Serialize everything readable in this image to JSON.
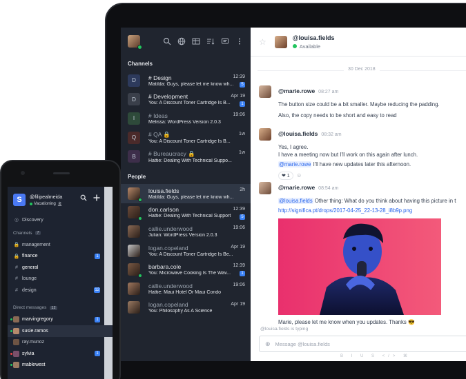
{
  "colors": {
    "accent": "#3b82f6",
    "online": "#22c55e",
    "sidebar": "#20252f",
    "mention_bg": "#e8efff",
    "link": "#2563eb"
  },
  "tablet": {
    "sidebar": {
      "icons": [
        "search-icon",
        "globe-icon",
        "grid-icon",
        "sort-icon",
        "compose-icon",
        "more-icon"
      ],
      "channels_title": "Channels",
      "channels": [
        {
          "initial": "D",
          "name": "# Design",
          "preview": "Matilda: Guys, please let me know wh...",
          "time": "12:39",
          "badge": "5",
          "color": "#2d3a5c",
          "dim": false
        },
        {
          "initial": "D",
          "name": "# Development",
          "preview": "You: A Discount Toner Cartridge Is B...",
          "time": "Apr 19",
          "badge": "1",
          "color": "#3a3f4a",
          "dim": false
        },
        {
          "initial": "I",
          "name": "# Ideas",
          "preview": "Melissa: WordPress Version 2.0.3",
          "time": "19:06",
          "badge": "",
          "color": "#2e4a3a",
          "dim": true
        },
        {
          "initial": "Q",
          "name": "# QA 🔒",
          "preview": "You: A Discount Toner Cartridge Is B...",
          "time": "1w",
          "badge": "",
          "color": "#4a2a2a",
          "dim": true
        },
        {
          "initial": "B",
          "name": "# Bureaucracy 🔒",
          "preview": "Hattie: Dealing With Technical Suppo...",
          "time": "1w",
          "badge": "",
          "color": "#3d2e4a",
          "dim": true
        }
      ],
      "people_title": "People",
      "people": [
        {
          "name": "louisa.fields",
          "preview": "Matilda: Guys, please let me know wh...",
          "time": "2h",
          "badge": "",
          "online": true,
          "av": "#b7896a",
          "dim": false,
          "selected": true
        },
        {
          "name": "don.carlson",
          "preview": "Hattie: Dealing With Technical Support",
          "time": "12:39",
          "badge": "5",
          "online": true,
          "av": "#6b4b3a",
          "dim": false,
          "selected": false
        },
        {
          "name": "callie.underwood",
          "preview": "Julian: WordPress Version 2.0.3",
          "time": "19:06",
          "badge": "",
          "online": false,
          "av": "#8a6a55",
          "dim": true,
          "selected": false
        },
        {
          "name": "logan.copeland",
          "preview": "You: A Discount Toner Cartridge Is Be...",
          "time": "Apr 19",
          "badge": "",
          "online": false,
          "av": "#c5c5c5",
          "dim": true,
          "selected": false
        },
        {
          "name": "barbara.cole",
          "preview": "You: Microwave Cooking Is The Wav...",
          "time": "12:39",
          "badge": "1",
          "online": true,
          "av": "#7b5a44",
          "dim": false,
          "selected": false
        },
        {
          "name": "callie.underwood",
          "preview": "Hattie: Maui Hotel Or Maui Condo",
          "time": "19:06",
          "badge": "",
          "online": false,
          "av": "#a0785f",
          "dim": true,
          "selected": false
        },
        {
          "name": "logan.copeland",
          "preview": "You: Philosophy As A Science",
          "time": "Apr 19",
          "badge": "",
          "online": false,
          "av": "#9a7a62",
          "dim": true,
          "selected": false
        }
      ]
    },
    "chat": {
      "name": "@louisa.fields",
      "status": "Available",
      "date": "30 Dec 2018",
      "messages": [
        {
          "user": "@marie.rowe",
          "time": "08:27 am",
          "lines": [
            "The button size could be a bit smaller. Maybe reducing the padding.",
            "Also, the copy needs to be short and easy to read"
          ]
        },
        {
          "user": "@louisa.fields",
          "time": "08:32 am",
          "lines": [
            "Yes, I agree.",
            "I have a meeting now but I'll work on this again after lunch."
          ],
          "mention": "@marie.rowe",
          "mention_rest": " I'll have new updates later this afternoon.",
          "reaction": "❤ 1"
        },
        {
          "user": "@marie.rowe",
          "time": "08:54 am",
          "mention": "@louisa.fields",
          "mention_rest": " Other thing: What do you think about having this picture in t",
          "link": "http://significa.pt/drops/2017-04-25_22-13-28_i8b9p.png",
          "after": "Marie, please let me know when you updates. Thanks 😎"
        }
      ],
      "typing": "@louisa.fields is typing",
      "placeholder": "Message @louisa.fields",
      "format": "B I U S </> ⌘"
    }
  },
  "phone": {
    "user": "@filipealmeida",
    "status": "Vacationing",
    "status_emoji": "🏝",
    "avatar_letter": "S",
    "discovery": "Discovery",
    "channels_title": "Channels",
    "channels_count": "7",
    "channels": [
      {
        "icon": "🔒",
        "name": "management",
        "badge": "",
        "sel": false
      },
      {
        "icon": "🔒",
        "name": "finance",
        "badge": "1",
        "sel": false,
        "bright": true
      },
      {
        "icon": "#",
        "name": "general",
        "badge": "",
        "sel": false,
        "bright": true
      },
      {
        "icon": "#",
        "name": "lounge",
        "badge": "",
        "sel": false
      },
      {
        "icon": "#",
        "name": "design",
        "badge": "12",
        "sel": false
      }
    ],
    "dm_title": "Direct messages",
    "dm_count": "12",
    "dms": [
      {
        "name": "marvingregory",
        "badge": "1",
        "sel": false,
        "dot": "#22c55e",
        "av": "#8a6a55",
        "bright": true
      },
      {
        "name": "susie.ramos",
        "badge": "",
        "sel": true,
        "dot": "#22c55e",
        "av": "#b58a6c",
        "bright": false
      },
      {
        "name": "ray.munoz",
        "badge": "",
        "sel": false,
        "dot": "",
        "av": "#6d5444",
        "bright": false
      },
      {
        "name": "sylvia",
        "badge": "1",
        "sel": false,
        "dot": "#ef4444",
        "av": "#7a4f6a",
        "bright": true
      },
      {
        "name": "mablewest",
        "badge": "",
        "sel": false,
        "dot": "#22c55e",
        "av": "#9c7b63",
        "bright": true
      }
    ]
  }
}
